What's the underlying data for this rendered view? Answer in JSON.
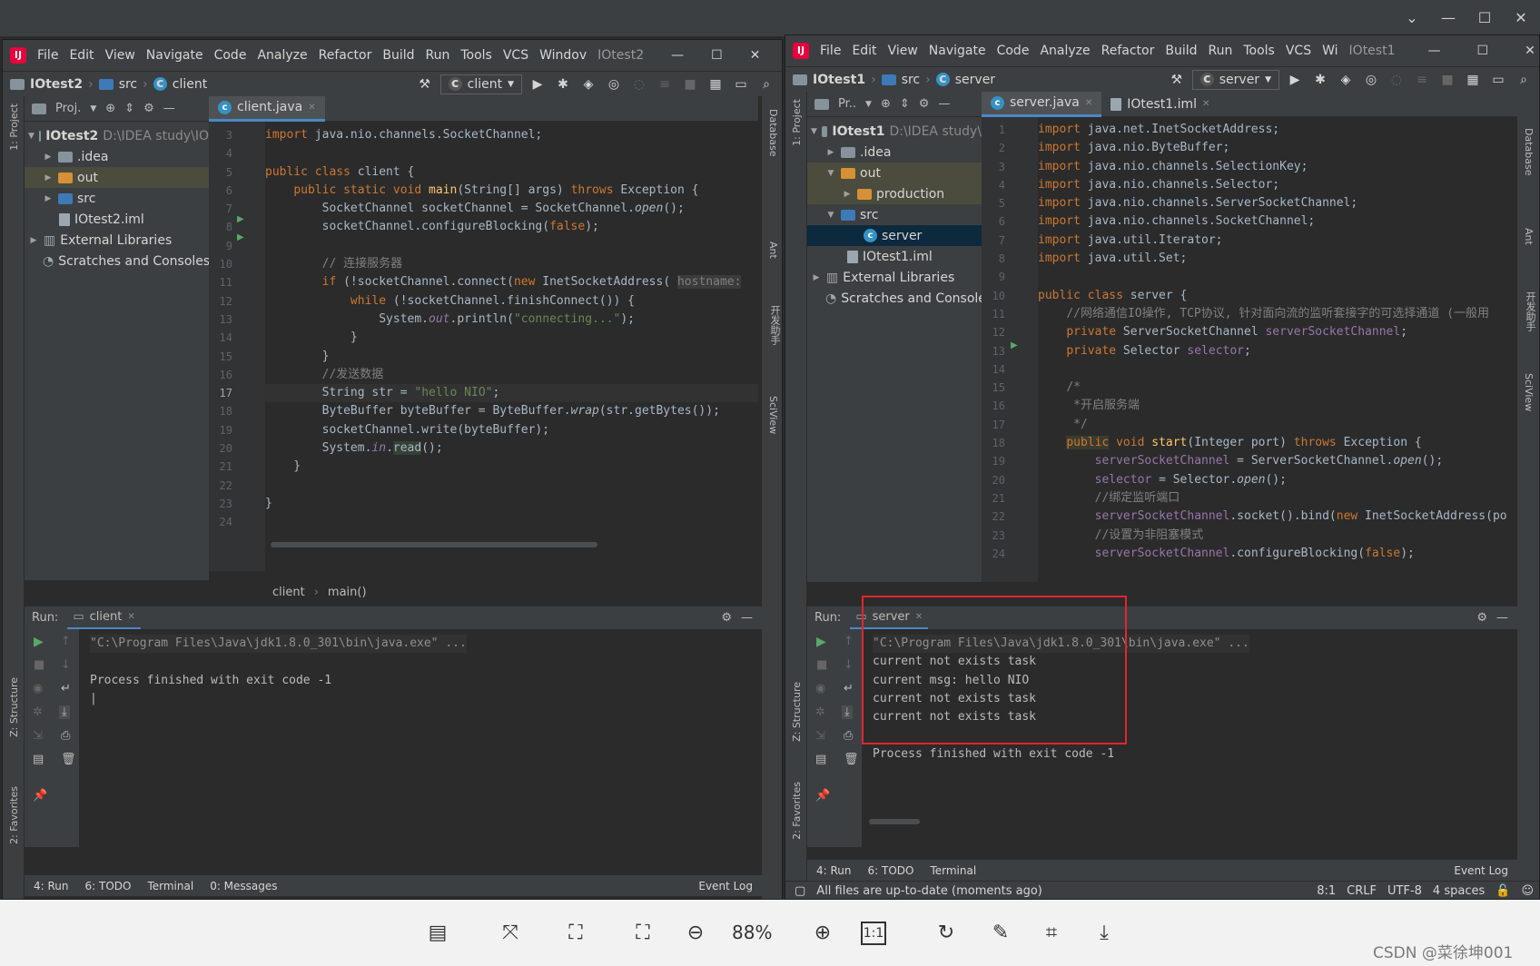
{
  "viewer": {
    "zoom": "88%",
    "watermark": "CSDN @菜徐坤001",
    "window_controls": [
      "chevron-down-icon",
      "minimize-icon",
      "maximize-icon",
      "close-icon"
    ]
  },
  "left_ide": {
    "menu": [
      "File",
      "Edit",
      "View",
      "Navigate",
      "Code",
      "Analyze",
      "Refactor",
      "Build",
      "Run",
      "Tools",
      "VCS",
      "Windov"
    ],
    "title": "IOtest2",
    "breadcrumb": {
      "project": "IOtest2",
      "folder": "src",
      "file": "client"
    },
    "run_config": "client",
    "project_pane_label": "Proj.",
    "tree": [
      {
        "label": "IOtest2",
        "path": "D:\\IDEA study\\IO",
        "kind": "project"
      },
      {
        "label": ".idea",
        "kind": "folder"
      },
      {
        "label": "out",
        "kind": "folder-orange"
      },
      {
        "label": "src",
        "kind": "folder"
      },
      {
        "label": "IOtest2.iml",
        "kind": "iml"
      },
      {
        "label": "External Libraries",
        "kind": "lib"
      },
      {
        "label": "Scratches and Consoles",
        "kind": "scratch"
      }
    ],
    "tab": "client.java",
    "gutter_lines": [
      "3",
      "4",
      "5",
      "6",
      "7",
      "8",
      "9",
      "10",
      "11",
      "12",
      "13",
      "14",
      "15",
      "16",
      "17",
      "18",
      "19",
      "20",
      "21",
      "22",
      "23",
      "24"
    ],
    "code_breadcrumb": {
      "cls": "client",
      "method": "main()"
    },
    "hint": "hostname:",
    "run_label": "Run:",
    "run_tab": "client",
    "console": {
      "cmd": "\"C:\\Program Files\\Java\\jdk1.8.0_301\\bin\\java.exe\" ...",
      "finish": "Process finished with exit code -1"
    },
    "bottom_tools": [
      "4: Run",
      "6: TODO",
      "Terminal",
      "0: Messages"
    ],
    "event_log": "Event Log",
    "side_left": [
      "1: Project",
      "Z: Structure",
      "2: Favorites"
    ],
    "side_right": [
      "Database",
      "Ant",
      "开发助手",
      "SciView"
    ]
  },
  "right_ide": {
    "menu": [
      "File",
      "Edit",
      "View",
      "Navigate",
      "Code",
      "Analyze",
      "Refactor",
      "Build",
      "Run",
      "Tools",
      "VCS",
      "Wi"
    ],
    "title": "IOtest1",
    "breadcrumb": {
      "project": "IOtest1",
      "folder": "src",
      "file": "server"
    },
    "run_config": "server",
    "project_pane_label": "Pr..",
    "tree": [
      {
        "label": "IOtest1",
        "path": "D:\\IDEA study\\",
        "kind": "project"
      },
      {
        "label": ".idea",
        "kind": "folder"
      },
      {
        "label": "out",
        "kind": "folder-orange"
      },
      {
        "label": "production",
        "kind": "folder-orange"
      },
      {
        "label": "src",
        "kind": "folder"
      },
      {
        "label": "server",
        "kind": "class"
      },
      {
        "label": "IOtest1.iml",
        "kind": "iml"
      },
      {
        "label": "External Libraries",
        "kind": "lib"
      },
      {
        "label": "Scratches and Consoles",
        "kind": "scratch"
      }
    ],
    "tabs": [
      "server.java",
      "IOtest1.iml"
    ],
    "gutter_lines": [
      "1",
      "2",
      "3",
      "4",
      "5",
      "6",
      "7",
      "8",
      "9",
      "10",
      "11",
      "12",
      "13",
      "14",
      "15",
      "16",
      "17",
      "18",
      "19",
      "20",
      "21",
      "22",
      "23",
      "24"
    ],
    "run_label": "Run:",
    "run_tab": "server",
    "console": {
      "cmd": "\"C:\\Program Files\\Java\\jdk1.8.0_301\\bin\\java.exe\" ...",
      "lines": [
        "current not exists task",
        "current msg: hello NIO",
        "current not exists task",
        "current not exists task"
      ],
      "finish": "Process finished with exit code -1"
    },
    "bottom_tools": [
      "4: Run",
      "6: TODO",
      "Terminal"
    ],
    "event_log": "Event Log",
    "status": {
      "message": "All files are up-to-date (moments ago)",
      "pos": "8:1",
      "eol": "CRLF",
      "enc": "UTF-8",
      "indent": "4 spaces"
    },
    "side_left": [
      "1: Project",
      "Z: Structure",
      "2: Favorites"
    ],
    "side_right": [
      "Database",
      "Ant",
      "开发助手",
      "SciView"
    ]
  }
}
